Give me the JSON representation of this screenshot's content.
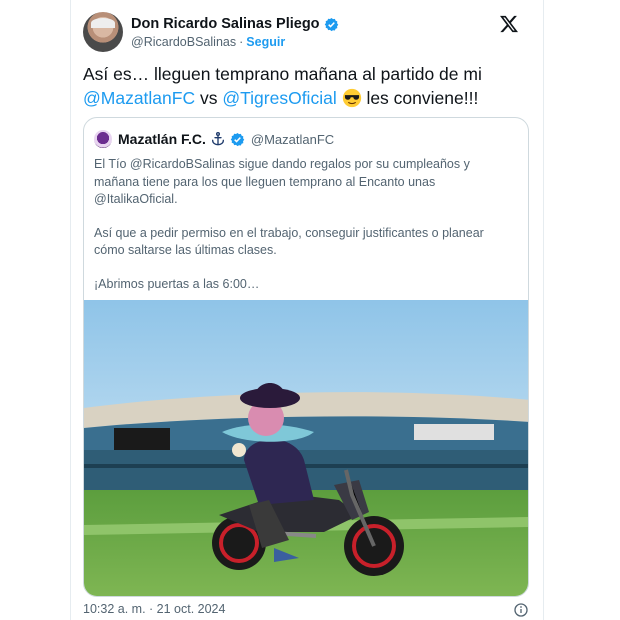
{
  "author": {
    "name": "Don Ricardo Salinas Pliego",
    "handle": "@RicardoBSalinas",
    "separator": "·",
    "follow_label": "Seguir"
  },
  "tweet": {
    "part1": "Así es… lleguen temprano mañana al partido de mi ",
    "mention1": "@MazatlanFC",
    "part2": " vs ",
    "mention2": "@TigresOficial",
    "part3": " les conviene!!!"
  },
  "quoted": {
    "name": "Mazatlán F.C.",
    "handle": "@MazatlanFC",
    "paragraphs": [
      "El Tío @RicardoBSalinas sigue dando regalos por su cumpleaños y mañana tiene para los que lleguen temprano al Encanto unas @ItalikaOficial.",
      "Así que a pedir permiso en el trabajo, conseguir justificantes o planear cómo saltarse las últimas clases.",
      "¡Abrimos puertas a las 6:00…"
    ]
  },
  "timestamp": "10:32 a. m. · 21 oct. 2024",
  "colors": {
    "accent": "#1d9bf0",
    "text": "#0f1419",
    "muted": "#536471"
  },
  "icons": [
    "verified-badge-icon",
    "x-logo-icon",
    "anchor-icon",
    "sunglasses-emoji-icon",
    "info-icon"
  ]
}
